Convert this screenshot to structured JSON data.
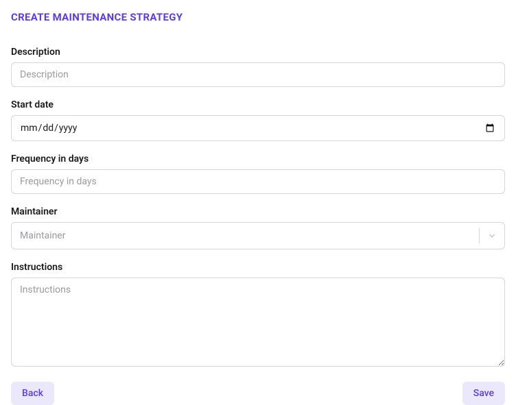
{
  "title": "CREATE MAINTENANCE STRATEGY",
  "fields": {
    "description": {
      "label": "Description",
      "placeholder": "Description",
      "value": ""
    },
    "start_date": {
      "label": "Start date",
      "placeholder": "mm/dd/yyyy",
      "value": ""
    },
    "frequency": {
      "label": "Frequency in days",
      "placeholder": "Frequency in days",
      "value": ""
    },
    "maintainer": {
      "label": "Maintainer",
      "placeholder": "Maintainer",
      "value": ""
    },
    "instructions": {
      "label": "Instructions",
      "placeholder": "Instructions",
      "value": ""
    }
  },
  "buttons": {
    "back": "Back",
    "save": "Save"
  }
}
